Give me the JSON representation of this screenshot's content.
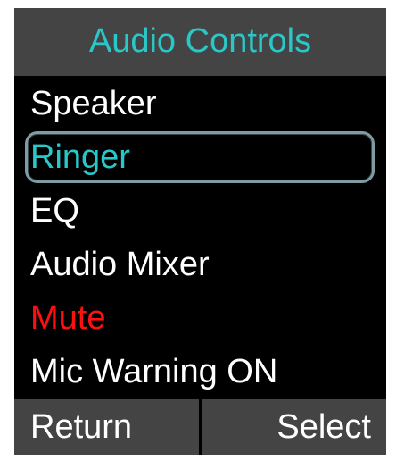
{
  "header": {
    "title": "Audio Controls"
  },
  "menu": {
    "items": [
      {
        "label": "Speaker",
        "state": "normal"
      },
      {
        "label": "Ringer",
        "state": "selected"
      },
      {
        "label": "EQ",
        "state": "normal"
      },
      {
        "label": "Audio Mixer",
        "state": "normal"
      },
      {
        "label": "Mute",
        "state": "warning"
      },
      {
        "label": "Mic Warning ON",
        "state": "normal"
      }
    ]
  },
  "softkeys": {
    "left": "Return",
    "right": "Select"
  },
  "colors": {
    "screen_background": "#000000",
    "bar_background": "#444444",
    "accent": "#2ac7c9",
    "selection_border": "#7f9ca5",
    "text": "#ffffff",
    "warning": "#ff1010"
  }
}
